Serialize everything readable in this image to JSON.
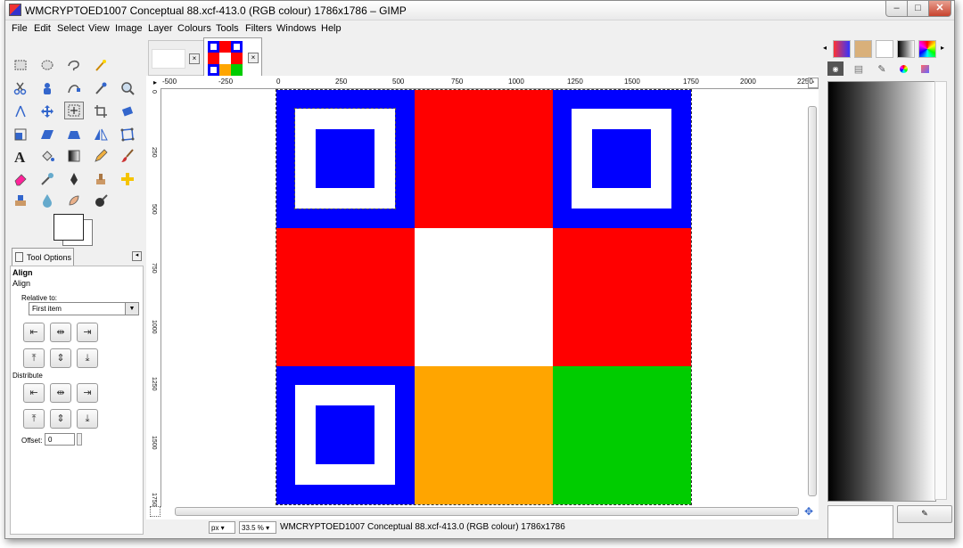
{
  "window": {
    "title": "WMCRYPTOED1007 Conceptual 88.xcf-413.0 (RGB colour) 1786x1786 – GIMP",
    "buttons": {
      "minimize": "–",
      "maximize": "□",
      "close": "✕"
    }
  },
  "menu": [
    "File",
    "Edit",
    "Select",
    "View",
    "Image",
    "Layer",
    "Colours",
    "Tools",
    "Filters",
    "Windows",
    "Help"
  ],
  "tool_options": {
    "tab_label": "Tool Options",
    "tool_name": "Align",
    "section": "Align",
    "relative_to_label": "Relative to:",
    "relative_to_value": "First item",
    "distribute_label": "Distribute",
    "offset_label": "Offset:",
    "offset_value": "0"
  },
  "ruler": {
    "h_ticks": [
      "-500",
      "-250",
      "0",
      "250",
      "500",
      "750",
      "1000",
      "1250",
      "1500",
      "1750",
      "2000",
      "2250"
    ],
    "v_ticks": [
      "0",
      "250",
      "500",
      "750",
      "1000",
      "1250",
      "1500",
      "1750"
    ]
  },
  "image": {
    "colors": {
      "blue": "#0000ff",
      "red": "#ff0000",
      "white": "#ffffff",
      "orange": "#ffa500",
      "green": "#00cc00"
    },
    "grid": [
      [
        "blue-frame",
        "red",
        "blue-frame"
      ],
      [
        "red",
        "white",
        "red"
      ],
      [
        "blue-frame",
        "orange",
        "green"
      ]
    ]
  },
  "status": {
    "unit": "px",
    "zoom": "33.5 %",
    "text": "WMCRYPTOED1007 Conceptual 88.xcf-413.0 (RGB colour) 1786x1786"
  }
}
